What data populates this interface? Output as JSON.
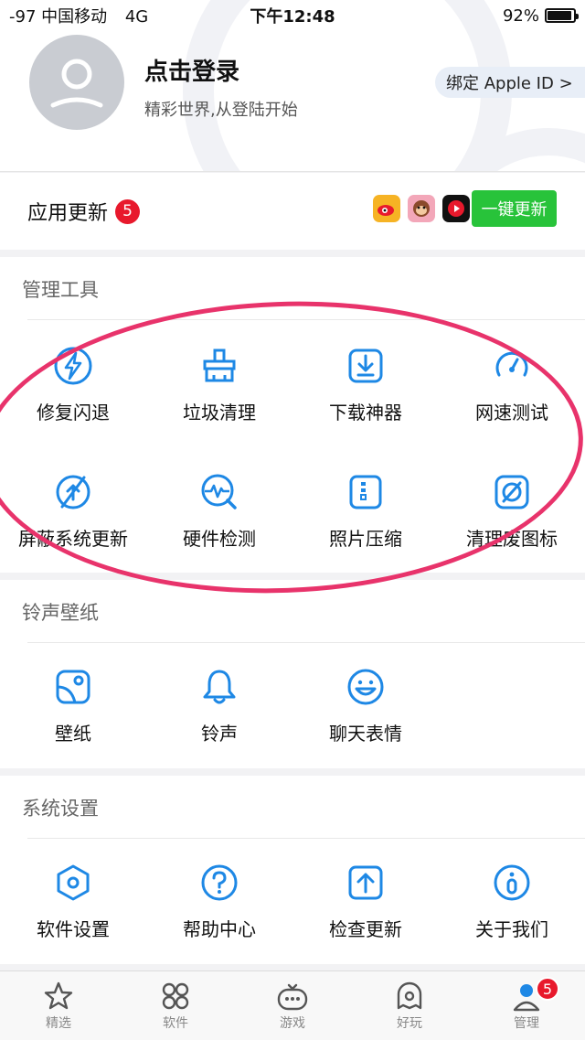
{
  "status": {
    "carrier": "-97 中国移动",
    "network": "4G",
    "time": "下午12:48",
    "battery": "92%",
    "battery_level": 0.92
  },
  "profile": {
    "title": "点击登录",
    "subtitle": "精彩世界,从登陆开始",
    "apple_button": "绑定 Apple ID  >"
  },
  "updates": {
    "label": "应用更新",
    "count": "5",
    "icons": [
      "weibo-app-icon",
      "monkey-app-icon",
      "video-app-icon"
    ],
    "button": "一键更新"
  },
  "manage": {
    "title": "管理工具",
    "items": [
      {
        "label": "修复闪退",
        "icon": "lightning-icon"
      },
      {
        "label": "垃圾清理",
        "icon": "brush-icon"
      },
      {
        "label": "下载神器",
        "icon": "download-icon"
      },
      {
        "label": "网速测试",
        "icon": "speedometer-icon"
      },
      {
        "label": "屏蔽系统更新",
        "icon": "block-update-icon"
      },
      {
        "label": "硬件检测",
        "icon": "hardware-check-icon"
      },
      {
        "label": "照片压缩",
        "icon": "photo-compress-icon"
      },
      {
        "label": "清理废图标",
        "icon": "clean-icon"
      }
    ]
  },
  "ringtone": {
    "title": "铃声壁纸",
    "items": [
      {
        "label": "壁纸",
        "icon": "wallpaper-icon"
      },
      {
        "label": "铃声",
        "icon": "bell-icon"
      },
      {
        "label": "聊天表情",
        "icon": "smiley-icon"
      }
    ]
  },
  "settings": {
    "title": "系统设置",
    "items": [
      {
        "label": "软件设置",
        "icon": "settings-hexagon-icon"
      },
      {
        "label": "帮助中心",
        "icon": "help-icon"
      },
      {
        "label": "检查更新",
        "icon": "check-update-icon"
      },
      {
        "label": "关于我们",
        "icon": "info-icon"
      }
    ]
  },
  "tabbar": {
    "tabs": [
      {
        "label": "精选",
        "icon": "star-icon"
      },
      {
        "label": "软件",
        "icon": "apps-grid-icon"
      },
      {
        "label": "游戏",
        "icon": "game-robot-icon"
      },
      {
        "label": "好玩",
        "icon": "ghost-icon"
      },
      {
        "label": "管理",
        "icon": "user-manage-icon"
      }
    ],
    "manage_badge": "5"
  },
  "colors": {
    "accent": "#1e88e5",
    "update_green": "#28c33a",
    "badge_red": "#e8192c",
    "annotation_pink": "#e8336b"
  }
}
